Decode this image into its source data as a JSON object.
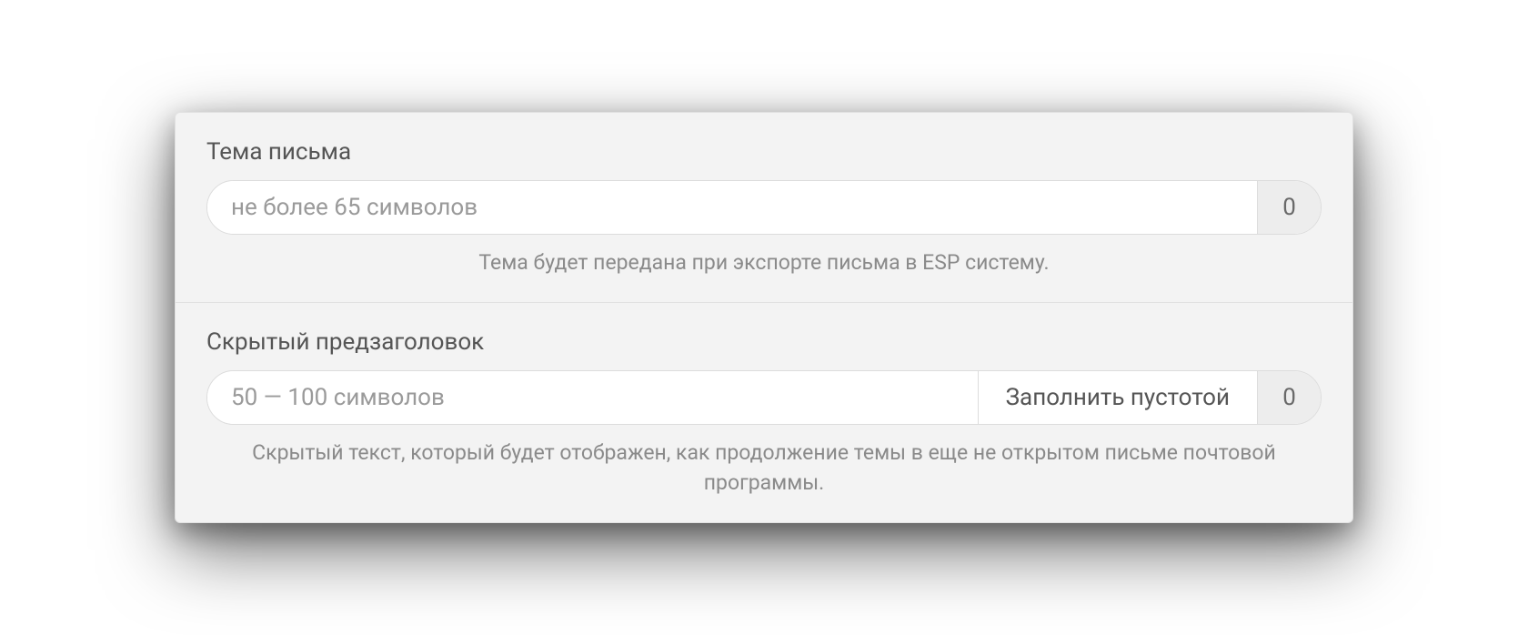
{
  "subject": {
    "label": "Тема письма",
    "placeholder": "не более 65 символов",
    "value": "",
    "count": "0",
    "hint": "Тема будет передана при экспорте письма в ESP систему."
  },
  "preheader": {
    "label": "Скрытый предзаголовок",
    "placeholder": "50 — 100 символов",
    "value": "",
    "fill_button": "Заполнить пустотой",
    "count": "0",
    "hint": "Скрытый текст, который будет отображен, как продолжение темы в еще не открытом письме почтовой программы."
  }
}
